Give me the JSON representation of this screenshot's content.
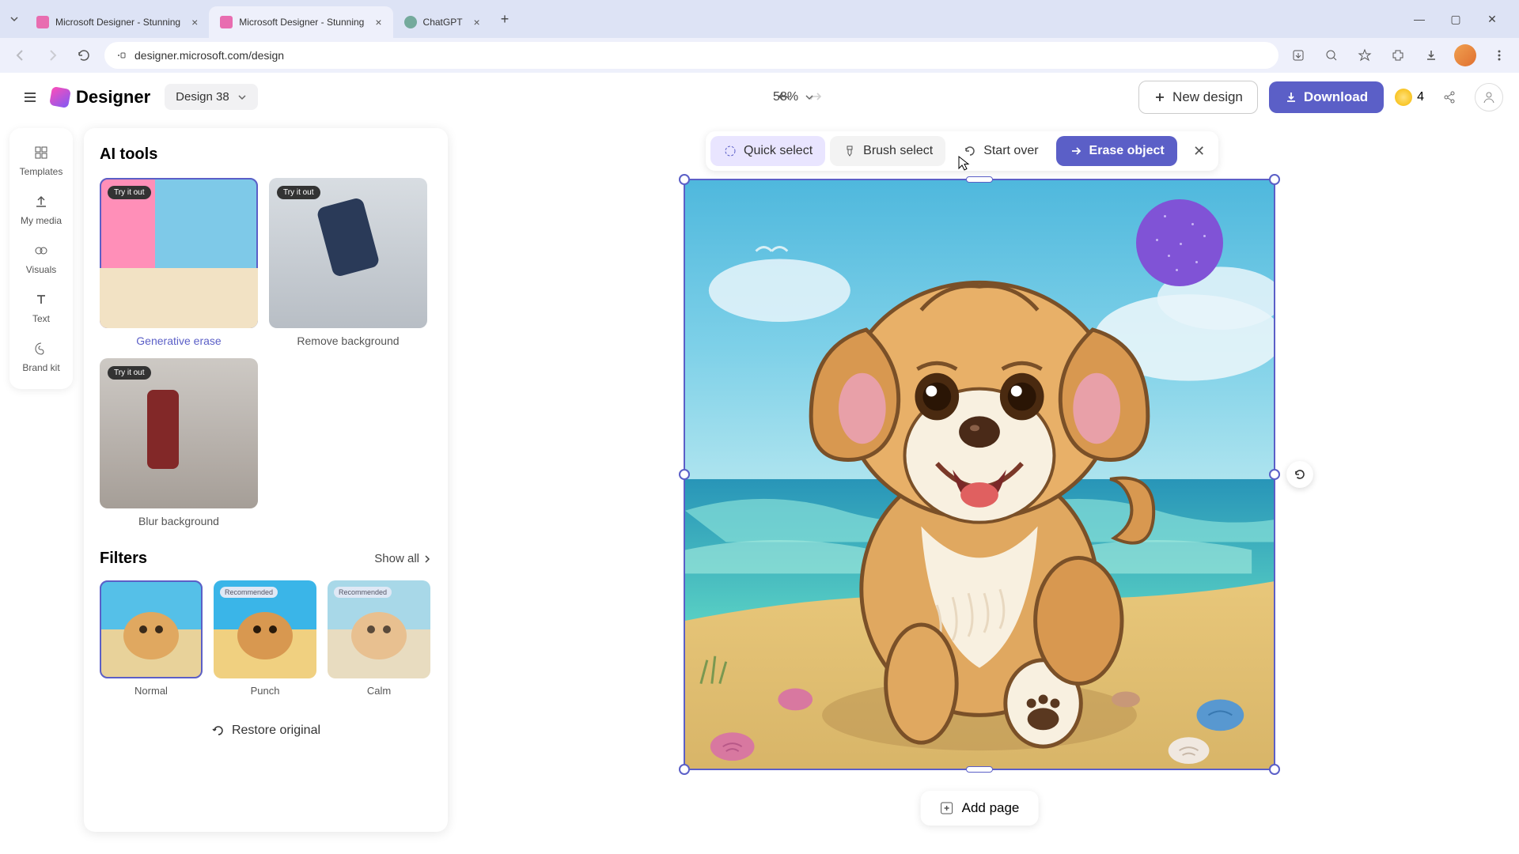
{
  "browser": {
    "tabs": [
      {
        "title": "Microsoft Designer - Stunning",
        "favicon_color": "#e86db0"
      },
      {
        "title": "Microsoft Designer - Stunning",
        "favicon_color": "#e86db0"
      },
      {
        "title": "ChatGPT",
        "favicon_color": "#74aa9c"
      }
    ],
    "url": "designer.microsoft.com/design"
  },
  "app": {
    "name": "Designer",
    "design_name": "Design 38",
    "zoom": "58%",
    "new_design_label": "New design",
    "download_label": "Download",
    "credits": "4"
  },
  "left_rail": {
    "templates": "Templates",
    "my_media": "My media",
    "visuals": "Visuals",
    "text": "Text",
    "brand_kit": "Brand kit"
  },
  "panel": {
    "ai_tools_title": "AI tools",
    "try_badge": "Try it out",
    "tools": {
      "generative_erase": "Generative erase",
      "remove_background": "Remove background",
      "blur_background": "Blur background"
    },
    "filters_title": "Filters",
    "show_all": "Show all",
    "recommended_badge": "Recommended",
    "filters": {
      "normal": "Normal",
      "punch": "Punch",
      "calm": "Calm"
    },
    "restore_original": "Restore original"
  },
  "erase_toolbar": {
    "quick_select": "Quick select",
    "brush_select": "Brush select",
    "start_over": "Start over",
    "erase_object": "Erase object"
  },
  "canvas": {
    "add_page": "Add page"
  }
}
